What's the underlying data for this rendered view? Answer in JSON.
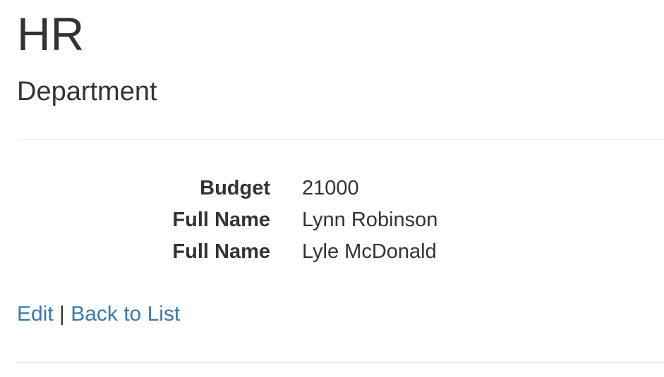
{
  "header": {
    "title": "HR",
    "subtitle": "Department"
  },
  "details": [
    {
      "label": "Budget",
      "value": "21000"
    },
    {
      "label": "Full Name",
      "value": "Lynn Robinson"
    },
    {
      "label": "Full Name",
      "value": "Lyle McDonald"
    }
  ],
  "actions": {
    "edit_label": "Edit",
    "separator": "|",
    "back_label": "Back to List"
  },
  "colors": {
    "link": "#337ab7",
    "text": "#333333",
    "rule": "#e5e5e5"
  }
}
